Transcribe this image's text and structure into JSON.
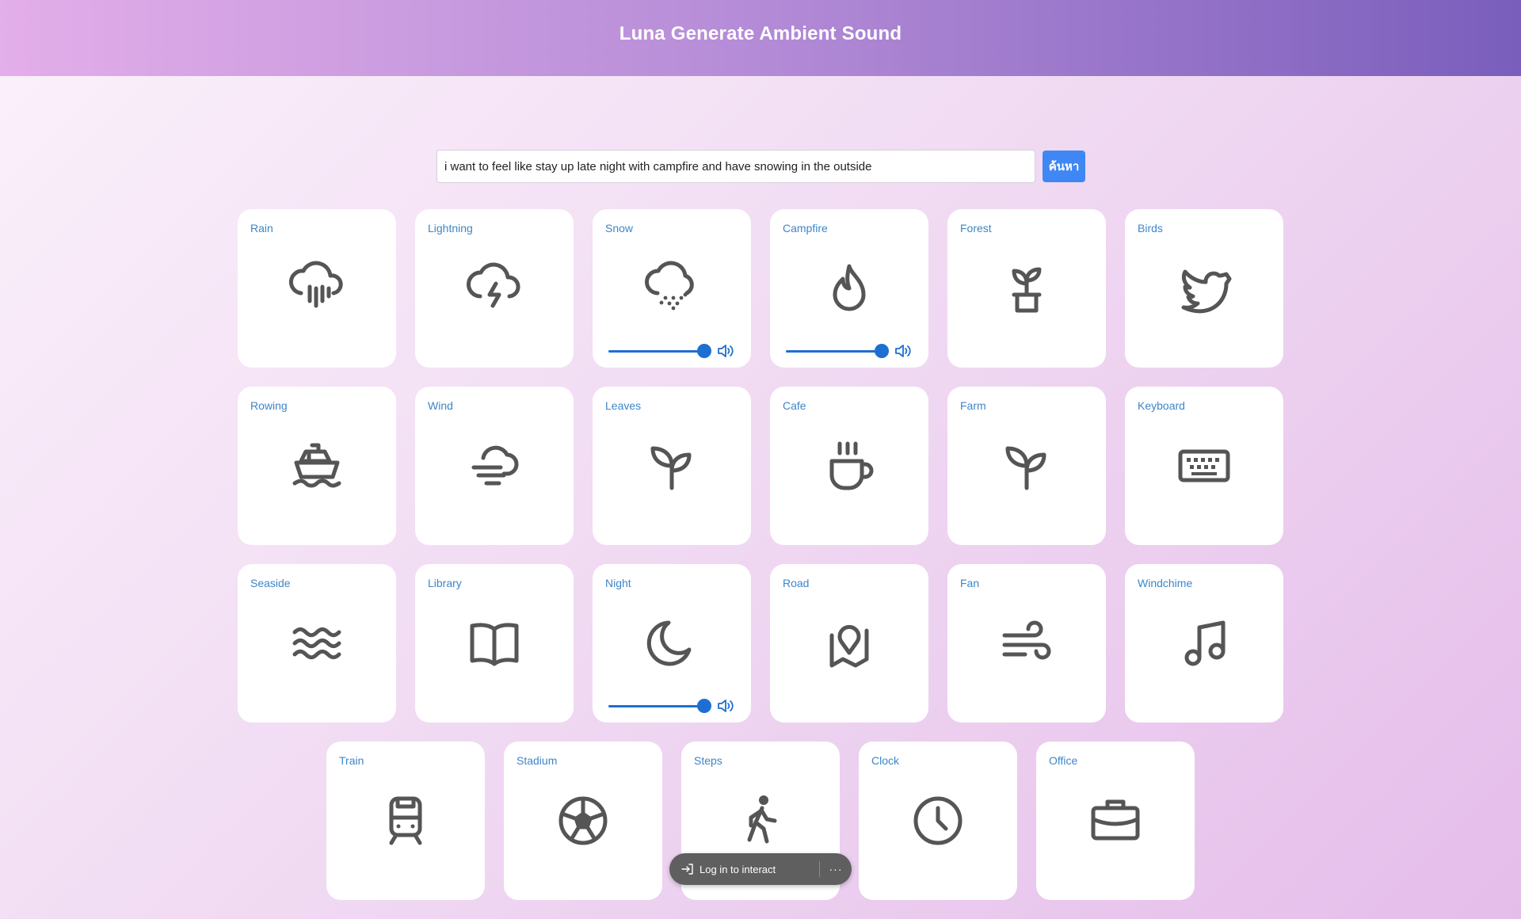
{
  "header": {
    "title": "Luna Generate Ambient Sound"
  },
  "search": {
    "value": "i want to feel like stay up late night with campfire and have snowing in the outside",
    "button_label": "ค้นหา"
  },
  "colors": {
    "accent": "#3f87f5",
    "slider": "#1d6fd1",
    "label": "#3d86c9",
    "icon": "#555555"
  },
  "rows": [
    [
      {
        "label": "Rain",
        "icon": "rain-icon",
        "active": false
      },
      {
        "label": "Lightning",
        "icon": "lightning-icon",
        "active": false
      },
      {
        "label": "Snow",
        "icon": "snow-icon",
        "active": true,
        "volume": 1
      },
      {
        "label": "Campfire",
        "icon": "flame-icon",
        "active": true,
        "volume": 1
      },
      {
        "label": "Forest",
        "icon": "potted-plant-icon",
        "active": false
      },
      {
        "label": "Birds",
        "icon": "bird-icon",
        "active": false
      }
    ],
    [
      {
        "label": "Rowing",
        "icon": "ship-icon",
        "active": false
      },
      {
        "label": "Wind",
        "icon": "cloud-wind-icon",
        "active": false
      },
      {
        "label": "Leaves",
        "icon": "sprout-icon",
        "active": false
      },
      {
        "label": "Cafe",
        "icon": "coffee-cup-icon",
        "active": false
      },
      {
        "label": "Farm",
        "icon": "sprout-icon",
        "active": false
      },
      {
        "label": "Keyboard",
        "icon": "keyboard-icon",
        "active": false
      }
    ],
    [
      {
        "label": "Seaside",
        "icon": "waves-icon",
        "active": false
      },
      {
        "label": "Library",
        "icon": "book-icon",
        "active": false
      },
      {
        "label": "Night",
        "icon": "moon-icon",
        "active": true,
        "volume": 1
      },
      {
        "label": "Road",
        "icon": "map-pin-icon",
        "active": false
      },
      {
        "label": "Fan",
        "icon": "wind-icon",
        "active": false
      },
      {
        "label": "Windchime",
        "icon": "music-note-icon",
        "active": false
      }
    ],
    [
      {
        "label": "Train",
        "icon": "train-icon",
        "active": false
      },
      {
        "label": "Stadium",
        "icon": "soccer-ball-icon",
        "active": false
      },
      {
        "label": "Steps",
        "icon": "walking-icon",
        "active": false
      },
      {
        "label": "Clock",
        "icon": "clock-icon",
        "active": false
      },
      {
        "label": "Office",
        "icon": "briefcase-icon",
        "active": false
      }
    ]
  ],
  "login": {
    "label": "Log in to interact",
    "more": "···"
  }
}
